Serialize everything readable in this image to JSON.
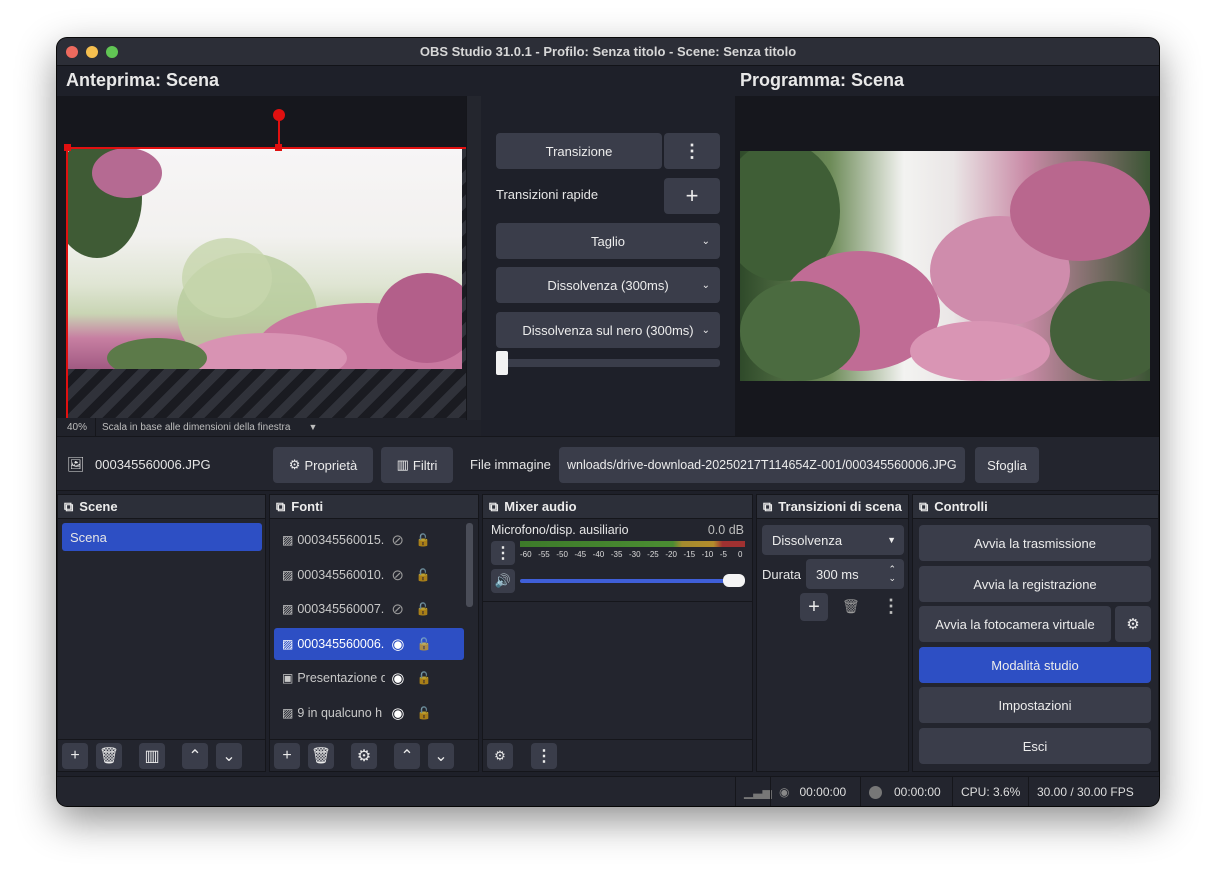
{
  "window": {
    "title": "OBS Studio 31.0.1 - Profilo: Senza titolo - Scene: Senza titolo"
  },
  "preview": {
    "label": "Anteprima: Scena",
    "zoom": "40%",
    "scale_mode": "Scala in base alle dimensioni della finestra"
  },
  "program": {
    "label": "Programma: Scena"
  },
  "transitions_center": {
    "transition_button": "Transizione",
    "quick_transitions_label": "Transizioni rapide",
    "quick": [
      "Taglio",
      "Dissolvenza (300ms)",
      "Dissolvenza sul nero (300ms)"
    ]
  },
  "source_bar": {
    "source_name": "000345560006.JPG",
    "properties_button": "Proprietà",
    "filters_button": "Filtri",
    "file_label": "File immagine",
    "file_path": "wnloads/drive-download-20250217T114654Z-001/000345560006.JPG",
    "browse_button": "Sfoglia"
  },
  "scenes": {
    "title": "Scene",
    "items": [
      "Scena"
    ]
  },
  "sources": {
    "title": "Fonti",
    "items": [
      {
        "name": "000345560015.",
        "visible": false,
        "selected": false,
        "icon": "image-icon"
      },
      {
        "name": "000345560010.",
        "visible": false,
        "selected": false,
        "icon": "image-icon"
      },
      {
        "name": "000345560007.",
        "visible": false,
        "selected": false,
        "icon": "image-icon"
      },
      {
        "name": "000345560006.",
        "visible": true,
        "selected": true,
        "icon": "image-icon"
      },
      {
        "name": "Presentazione d",
        "visible": true,
        "selected": false,
        "icon": "slideshow-icon"
      },
      {
        "name": "9 in qualcuno h",
        "visible": true,
        "selected": false,
        "icon": "image-icon"
      }
    ]
  },
  "mixer": {
    "title": "Mixer audio",
    "channel_name": "Microfono/disp. ausiliario",
    "level": "0.0 dB",
    "scale": [
      "-60",
      "-55",
      "-50",
      "-45",
      "-40",
      "-35",
      "-30",
      "-25",
      "-20",
      "-15",
      "-10",
      "-5",
      "0"
    ],
    "volume_fraction": 1.0
  },
  "scene_transitions": {
    "title": "Transizioni di scena",
    "selected": "Dissolvenza",
    "duration_label": "Durata",
    "duration_value": "300 ms"
  },
  "controls": {
    "title": "Controlli",
    "start_stream": "Avvia la trasmissione",
    "start_record": "Avvia la registrazione",
    "virtual_cam": "Avvia la fotocamera virtuale",
    "studio_mode": "Modalità studio",
    "settings": "Impostazioni",
    "exit": "Esci"
  },
  "status": {
    "stream_time": "00:00:00",
    "record_time": "00:00:00",
    "cpu": "CPU: 3.6%",
    "fps": "30.00 / 30.00 FPS"
  },
  "colors": {
    "accent": "#2d4fc4",
    "background": "#1e2029",
    "button": "#3a3d4a",
    "selection_red": "#e01010"
  }
}
